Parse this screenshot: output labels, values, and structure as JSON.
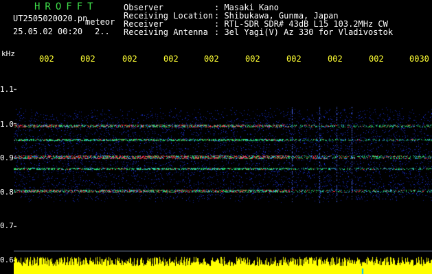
{
  "header": {
    "app_title": "HROFFT",
    "filename": "UT2505020020.pn",
    "filename_suffix": "meteor",
    "datetime": "25.05.02 00:20",
    "datetime_extra": "2..",
    "info": [
      {
        "label": "Observer",
        "value": ": Masaki Kano"
      },
      {
        "label": "Receiving Location",
        "value": ": Shibukawa, Gunma, Japan"
      },
      {
        "label": "Receiver",
        "value": ": RTL-SDR SDR# 43dB L15 103.2MHz CW"
      },
      {
        "label": "Receiving Antenna",
        "value": ": 3el Yagi(V) Az 330 for Vladivostok"
      }
    ]
  },
  "spectrogram": {
    "axis_unit": "kHz",
    "y_ticks": [
      "1.1",
      "1.0",
      "0.9",
      "0.8",
      "0.7",
      "0.6"
    ],
    "time_ticks": [
      "002",
      "002",
      "002",
      "002",
      "002",
      "002",
      "002",
      "002",
      "002",
      "0030"
    ]
  },
  "colors": {
    "background": "#000000",
    "title_green": "#3fe04a",
    "tick_yellow": "#ffff33",
    "noise_blue": "#1a2fd0",
    "signal_green": "#28e06a",
    "signal_red": "#ff2a3a",
    "level_yellow": "#ffff00"
  }
}
